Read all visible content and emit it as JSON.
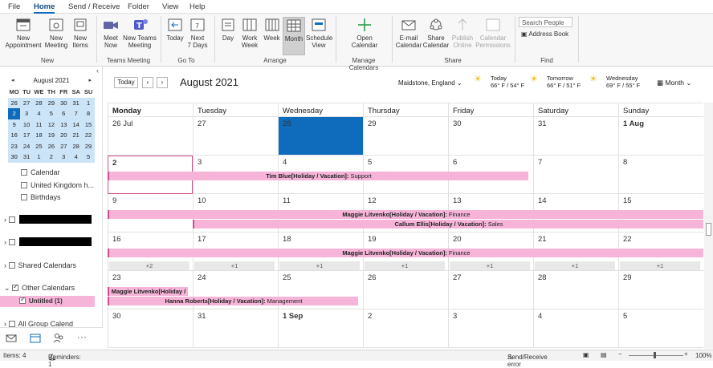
{
  "menu": [
    "File",
    "Home",
    "Send / Receive",
    "Folder",
    "View",
    "Help"
  ],
  "ribbon": {
    "new_appointment": "New\nAppointment",
    "new_meeting": "New\nMeeting",
    "new_items": "New\nItems",
    "meet_now": "Meet\nNow",
    "new_teams_meeting": "New Teams\nMeeting",
    "today": "Today",
    "next7": "Next\n7 Days",
    "day": "Day",
    "work_week": "Work\nWeek",
    "week": "Week",
    "month": "Month",
    "schedule_view": "Schedule\nView",
    "open_calendar": "Open\nCalendar",
    "email_calendar": "E-mail\nCalendar",
    "share_calendar": "Share\nCalendar",
    "publish_online": "Publish\nOnline",
    "calendar_permissions": "Calendar\nPermissions",
    "search_people_placeholder": "Search People",
    "address_book": "Address Book",
    "groups": [
      "New",
      "Teams Meeting",
      "Go To",
      "Arrange",
      "Manage Calendars",
      "Share",
      "Find"
    ]
  },
  "minical": {
    "title": "August 2021",
    "dow": [
      "MO",
      "TU",
      "WE",
      "TH",
      "FR",
      "SA",
      "SU"
    ],
    "weeks": [
      [
        "26",
        "27",
        "28",
        "29",
        "30",
        "31",
        "1"
      ],
      [
        "2",
        "3",
        "4",
        "5",
        "6",
        "7",
        "8"
      ],
      [
        "9",
        "10",
        "11",
        "12",
        "13",
        "14",
        "15"
      ],
      [
        "16",
        "17",
        "18",
        "19",
        "20",
        "21",
        "22"
      ],
      [
        "23",
        "24",
        "25",
        "26",
        "27",
        "28",
        "29"
      ],
      [
        "30",
        "31",
        "1",
        "2",
        "3",
        "4",
        "5"
      ]
    ]
  },
  "folders": {
    "calendar": "Calendar",
    "uk_holidays": "United Kingdom h...",
    "birthdays": "Birthdays",
    "shared_calendars": "Shared Calendars",
    "other_calendars": "Other Calendars",
    "untitled": "Untitled (1)",
    "all_group": "All Group Calend"
  },
  "calendar": {
    "today_btn": "Today",
    "title": "August 2021",
    "location": "Maidstone, England",
    "weather": [
      {
        "day": "Today",
        "temp": "66° F / 54° F"
      },
      {
        "day": "Tomorrow",
        "temp": "66° F / 51° F"
      },
      {
        "day": "Wednesday",
        "temp": "69° F / 55° F"
      }
    ],
    "view": "Month",
    "days": [
      "Monday",
      "Tuesday",
      "Wednesday",
      "Thursday",
      "Friday",
      "Saturday",
      "Sunday"
    ],
    "weeks": [
      [
        "26 Jul",
        "27",
        "28",
        "29",
        "30",
        "31",
        "1 Aug"
      ],
      [
        "2",
        "3",
        "4",
        "5",
        "6",
        "7",
        "8"
      ],
      [
        "9",
        "10",
        "11",
        "12",
        "13",
        "14",
        "15"
      ],
      [
        "16",
        "17",
        "18",
        "19",
        "20",
        "21",
        "22"
      ],
      [
        "23",
        "24",
        "25",
        "26",
        "27",
        "28",
        "29"
      ],
      [
        "30",
        "31",
        "1 Sep",
        "2",
        "3",
        "4",
        "5"
      ]
    ],
    "events": {
      "tim": {
        "name": "Tim Blue[Holiday / Vacation]:",
        "dept": " Support"
      },
      "maggie1": {
        "name": "Maggie Litvenko[Holiday / Vacation]:",
        "dept": " Finance"
      },
      "callum": {
        "name": "Callum Ellis[Holiday / Vacation]:",
        "dept": " Sales"
      },
      "maggie2": {
        "name": "Maggie Litvenko[Holiday / Vacation]:",
        "dept": " Finance"
      },
      "maggie3": {
        "name": "Maggie Litvenko[Holiday /",
        "dept": ""
      },
      "hanna": {
        "name": "Hanna Roberts[Holiday / Vacation]:",
        "dept": " Management"
      }
    },
    "more": [
      "+2",
      "+1",
      "+1",
      "+1",
      "+1",
      "+1",
      "+1"
    ]
  },
  "status": {
    "items": "Items: 4",
    "reminders": "Reminders: 1",
    "error": "Send/Receive error",
    "zoom": "100%"
  },
  "colors": {
    "accent": "#0f6cbd",
    "event": "#f5b4d8",
    "event_border": "#d14e8c"
  }
}
